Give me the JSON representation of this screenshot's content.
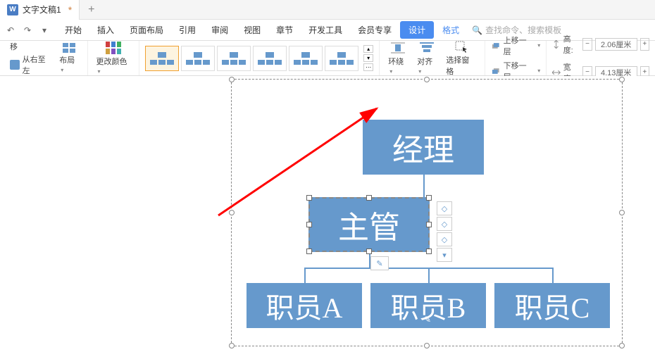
{
  "tab": {
    "icon_letter": "W",
    "title": "文字文稿1",
    "modified": "*",
    "add": "+"
  },
  "qat": {
    "undo": "↶",
    "redo": "↷"
  },
  "menu": {
    "start": "开始",
    "insert": "插入",
    "page_layout": "页面布局",
    "ref": "引用",
    "review": "审阅",
    "view": "视图",
    "chapter": "章节",
    "dev_tools": "开发工具",
    "member": "会员专享",
    "design": "设计",
    "format": "格式"
  },
  "search": {
    "placeholder": "查找命令、搜索模板"
  },
  "ribbon": {
    "move_label": "移",
    "rtl_label": "从右至左",
    "layout_label": "布局",
    "change_color": "更改颜色",
    "wrap": "环绕",
    "align": "对齐",
    "select_pane": "选择窗格",
    "move_up": "上移一层",
    "move_down": "下移一层",
    "height_label": "高度:",
    "width_label": "宽度:",
    "height_value": "2.06厘米",
    "width_value": "4.13厘米"
  },
  "chart_data": {
    "type": "org-chart",
    "nodes": [
      {
        "id": "manager",
        "label": "经理",
        "level": 0
      },
      {
        "id": "supervisor",
        "label": "主管",
        "level": 1,
        "parent": "manager",
        "selected": true
      },
      {
        "id": "empA",
        "label": "职员A",
        "level": 2,
        "parent": "supervisor"
      },
      {
        "id": "empB",
        "label": "职员B",
        "level": 2,
        "parent": "supervisor"
      },
      {
        "id": "empC",
        "label": "职员C",
        "level": 2,
        "parent": "supervisor"
      }
    ],
    "colors": {
      "node_bg": "#6699cc",
      "node_text": "#ffffff"
    }
  }
}
